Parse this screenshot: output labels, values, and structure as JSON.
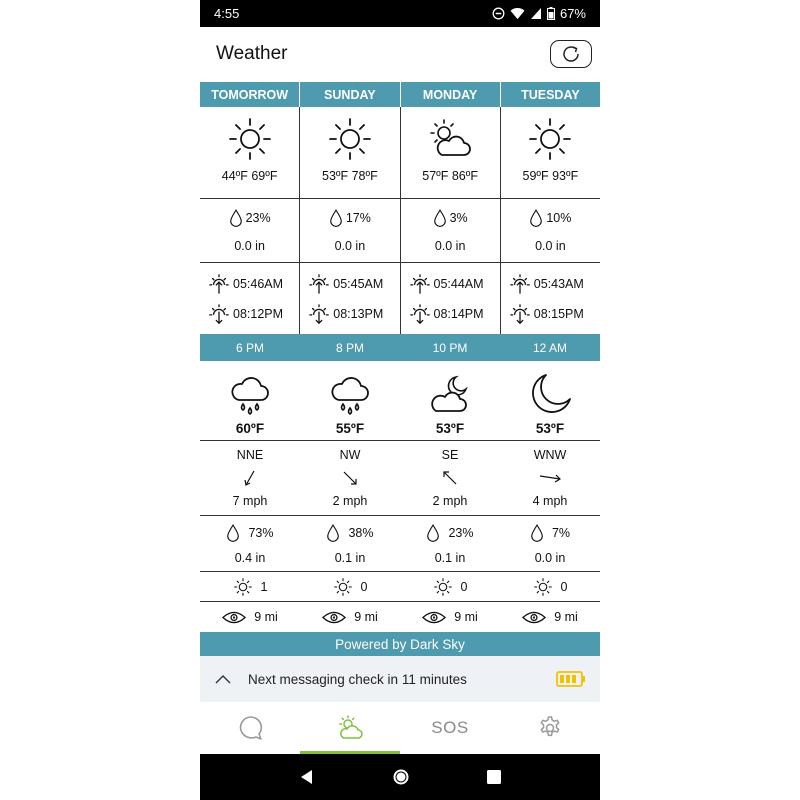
{
  "status_bar": {
    "time": "4:55",
    "battery": "67%"
  },
  "header": {
    "title": "Weather"
  },
  "daily": [
    {
      "day": "TOMORROW",
      "icon": "sun-icon",
      "temps": "44ºF 69ºF",
      "precip_chance": "23%",
      "precip_amount": "0.0 in",
      "sunrise": "05:46AM",
      "sunset": "08:12PM"
    },
    {
      "day": "SUNDAY",
      "icon": "sun-icon",
      "temps": "53ºF 78ºF",
      "precip_chance": "17%",
      "precip_amount": "0.0 in",
      "sunrise": "05:45AM",
      "sunset": "08:13PM"
    },
    {
      "day": "MONDAY",
      "icon": "partly-cloudy-day-icon",
      "temps": "57ºF 86ºF",
      "precip_chance": "3%",
      "precip_amount": "0.0 in",
      "sunrise": "05:44AM",
      "sunset": "08:14PM"
    },
    {
      "day": "TUESDAY",
      "icon": "sun-icon",
      "temps": "59ºF 93ºF",
      "precip_chance": "10%",
      "precip_amount": "0.0 in",
      "sunrise": "05:43AM",
      "sunset": "08:15PM"
    }
  ],
  "hourly": [
    {
      "time": "6 PM",
      "icon": "rain-icon",
      "temp": "60ºF",
      "wind_dir": "NNE",
      "wind_speed": "7 mph",
      "precip_chance": "73%",
      "precip_amount": "0.4 in",
      "uv": "1",
      "visibility": "9 mi"
    },
    {
      "time": "8 PM",
      "icon": "rain-icon",
      "temp": "55ºF",
      "wind_dir": "NW",
      "wind_speed": "2 mph",
      "precip_chance": "38%",
      "precip_amount": "0.1 in",
      "uv": "0",
      "visibility": "9 mi"
    },
    {
      "time": "10 PM",
      "icon": "partly-cloudy-night-icon",
      "temp": "53ºF",
      "wind_dir": "SE",
      "wind_speed": "2 mph",
      "precip_chance": "23%",
      "precip_amount": "0.1 in",
      "uv": "0",
      "visibility": "9 mi"
    },
    {
      "time": "12 AM",
      "icon": "moon-icon",
      "temp": "53ºF",
      "wind_dir": "WNW",
      "wind_speed": "4 mph",
      "precip_chance": "7%",
      "precip_amount": "0.0 in",
      "uv": "0",
      "visibility": "9 mi"
    }
  ],
  "footer": {
    "powered_by": "Powered by Dark Sky"
  },
  "message_bar": {
    "text": "Next messaging check in 11 minutes"
  },
  "nav": {
    "sos_label": "SOS",
    "active": "weather"
  },
  "colors": {
    "accent_teal": "#4e9aae",
    "active_green": "#7fc043",
    "battery_yellow": "#f2c200"
  }
}
